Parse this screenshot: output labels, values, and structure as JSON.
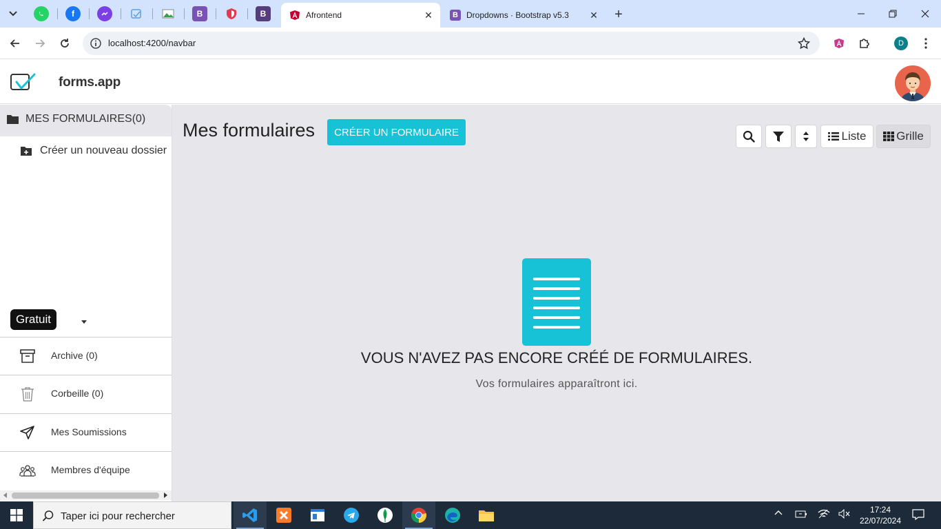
{
  "browser": {
    "tabs": [
      {
        "title": "Afrontend",
        "active": true
      },
      {
        "title": "Dropdowns · Bootstrap v5.3",
        "active": false
      }
    ],
    "url": "localhost:4200/navbar",
    "profile_initial": "D"
  },
  "app": {
    "brand": "forms.app",
    "colors": {
      "accent": "#17c2d6",
      "main_bg": "#e7e6eb"
    }
  },
  "sidebar": {
    "folder_header": "MES FORMULAIRES(0)",
    "new_folder": "Créer un nouveau dossier",
    "plan_badge": "Gratuit",
    "links": [
      {
        "label": "Archive (0)",
        "icon": "archive-icon"
      },
      {
        "label": "Corbeille (0)",
        "icon": "trash-icon"
      },
      {
        "label": "Mes Soumissions",
        "icon": "send-icon"
      },
      {
        "label": "Membres d'équipe",
        "icon": "team-icon"
      }
    ]
  },
  "main": {
    "title": "Mes formulaires",
    "create_button": "CRÉER UN FORMULAIRE",
    "toolbar": {
      "list_label": "Liste",
      "grid_label": "Grille",
      "active_view": "Grille"
    },
    "empty_title": "VOUS N'AVEZ PAS ENCORE CRÉÉ DE FORMULAIRES.",
    "empty_subtitle": "Vos formulaires apparaîtront ici."
  },
  "taskbar": {
    "search_placeholder": "Taper ici pour rechercher",
    "time": "17:24",
    "date": "22/07/2024"
  }
}
